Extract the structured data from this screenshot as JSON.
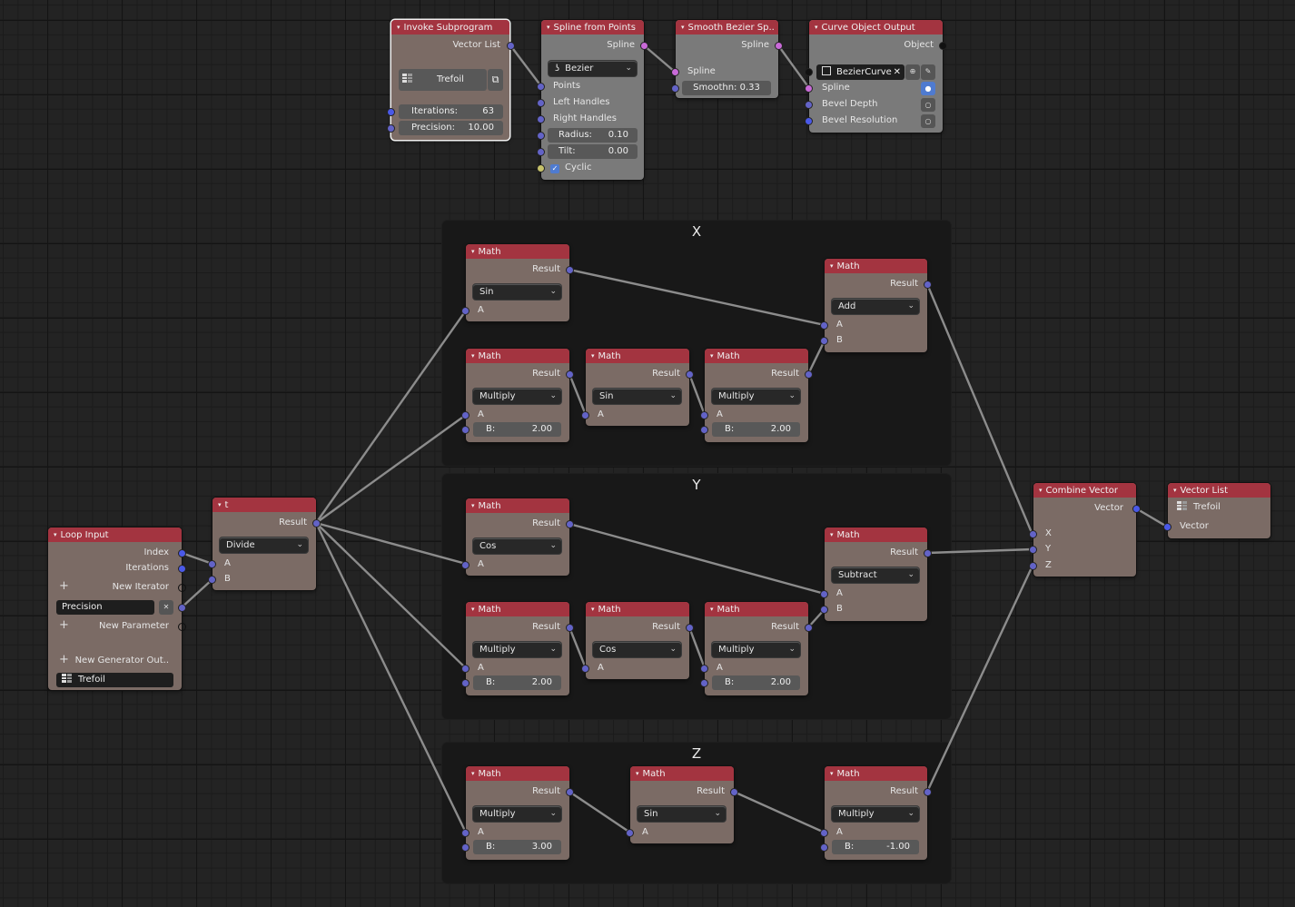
{
  "frames": {
    "x": {
      "label": "X"
    },
    "y": {
      "label": "Y"
    },
    "z": {
      "label": "Z"
    }
  },
  "invoke_subprogram": {
    "title": "Invoke Subprogram",
    "output": "Vector List",
    "subprogram": "Trefoil",
    "iterations_label": "Iterations:",
    "iterations_value": "63",
    "precision_label": "Precision:",
    "precision_value": "10.00"
  },
  "spline_from_points": {
    "title": "Spline from Points",
    "output": "Spline",
    "type": "Bezier",
    "inputs": [
      "Points",
      "Left Handles",
      "Right Handles"
    ],
    "radius_label": "Radius:",
    "radius_value": "0.10",
    "tilt_label": "Tilt:",
    "tilt_value": "0.00",
    "cyclic_label": "Cyclic",
    "cyclic_checked": true
  },
  "smooth_bezier": {
    "title": "Smooth Bezier Sp..",
    "output": "Spline",
    "input": "Spline",
    "smoothness": "Smoothn:  0.33"
  },
  "curve_object_output": {
    "title": "Curve Object Output",
    "output": "Object",
    "object_name": "BezierCurve",
    "inputs": [
      "Spline",
      "Bevel Depth",
      "Bevel Resolution"
    ]
  },
  "loop_input": {
    "title": "Loop Input",
    "outputs": [
      "Index",
      "Iterations"
    ],
    "new_iterator": "New Iterator",
    "parameter_name": "Precision",
    "new_parameter": "New Parameter",
    "new_generator_output": "New Generator Out..",
    "generator_list": "Trefoil"
  },
  "t_node": {
    "title": "t",
    "output": "Result",
    "operation": "Divide",
    "inputs": [
      "A",
      "B"
    ]
  },
  "math_nodes": {
    "x_sin": {
      "title": "Math",
      "output": "Result",
      "operation": "Sin",
      "a": "A"
    },
    "x_mul1": {
      "title": "Math",
      "output": "Result",
      "operation": "Multiply",
      "a": "A",
      "b_label": "B:",
      "b_value": "2.00"
    },
    "x_sin2": {
      "title": "Math",
      "output": "Result",
      "operation": "Sin",
      "a": "A"
    },
    "x_mul2": {
      "title": "Math",
      "output": "Result",
      "operation": "Multiply",
      "a": "A",
      "b_label": "B:",
      "b_value": "2.00"
    },
    "x_add": {
      "title": "Math",
      "output": "Result",
      "operation": "Add",
      "a": "A",
      "b": "B"
    },
    "y_cos": {
      "title": "Math",
      "output": "Result",
      "operation": "Cos",
      "a": "A"
    },
    "y_mul1": {
      "title": "Math",
      "output": "Result",
      "operation": "Multiply",
      "a": "A",
      "b_label": "B:",
      "b_value": "2.00"
    },
    "y_cos2": {
      "title": "Math",
      "output": "Result",
      "operation": "Cos",
      "a": "A"
    },
    "y_mul2": {
      "title": "Math",
      "output": "Result",
      "operation": "Multiply",
      "a": "A",
      "b_label": "B:",
      "b_value": "2.00"
    },
    "y_sub": {
      "title": "Math",
      "output": "Result",
      "operation": "Subtract",
      "a": "A",
      "b": "B"
    },
    "z_mul1": {
      "title": "Math",
      "output": "Result",
      "operation": "Multiply",
      "a": "A",
      "b_label": "B:",
      "b_value": "3.00"
    },
    "z_sin": {
      "title": "Math",
      "output": "Result",
      "operation": "Sin",
      "a": "A"
    },
    "z_mul2": {
      "title": "Math",
      "output": "Result",
      "operation": "Multiply",
      "a": "A",
      "b_label": "B:",
      "b_value": "-1.00"
    }
  },
  "combine_vector": {
    "title": "Combine Vector",
    "output": "Vector",
    "inputs": [
      "X",
      "Y",
      "Z"
    ]
  },
  "vector_list": {
    "title": "Vector List",
    "list_name": "Trefoil",
    "input": "Vector"
  },
  "icons": {
    "collapse": "▾",
    "chevron": "⌄",
    "close": "✕",
    "plus": "+",
    "check": "✓"
  },
  "colors": {
    "header": "#a33440",
    "node_body": "#7b6b65",
    "gray_body": "#7a7a7a",
    "socket_float": "#6363c7",
    "socket_int": "#4a59e8",
    "socket_spline": "#c96ad8",
    "socket_bool": "#c7c26a"
  }
}
